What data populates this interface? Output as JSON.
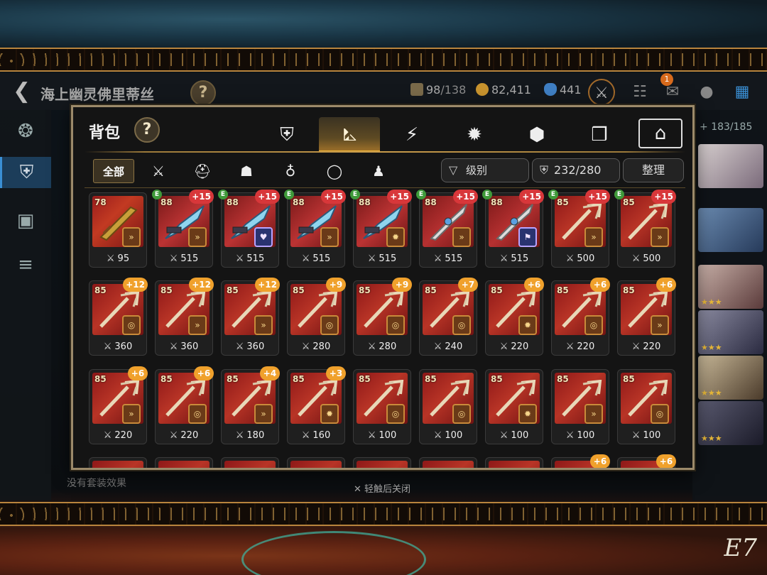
{
  "header": {
    "hero_name": "海上幽灵佛里蒂丝",
    "help": "?",
    "stamina": "98",
    "stamina_max": "/138",
    "gold": "82,411",
    "gems": "441",
    "mail_badge": "1"
  },
  "roster": {
    "count": "183/185"
  },
  "behind": {
    "no_set": "没有套装效果",
    "close_hint": "✕ 轻触后关闭"
  },
  "modal": {
    "title": "背包",
    "help": "?",
    "sub_all": "全部",
    "sort_label": "级别",
    "capacity": "232/280",
    "arrange": "整理"
  },
  "items": [
    {
      "lvl": "78",
      "enh": "",
      "enh_color": "",
      "e": false,
      "stat": "95",
      "art": "gold",
      "set": "»"
    },
    {
      "lvl": "88",
      "enh": "+15",
      "enh_color": "red",
      "e": true,
      "stat": "515",
      "art": "blue",
      "set": "»"
    },
    {
      "lvl": "88",
      "enh": "+15",
      "enh_color": "red",
      "e": true,
      "stat": "515",
      "art": "blue",
      "set": "♥"
    },
    {
      "lvl": "88",
      "enh": "+15",
      "enh_color": "red",
      "e": true,
      "stat": "515",
      "art": "blue",
      "set": "»"
    },
    {
      "lvl": "88",
      "enh": "+15",
      "enh_color": "red",
      "e": true,
      "stat": "515",
      "art": "blue",
      "set": "✹"
    },
    {
      "lvl": "88",
      "enh": "+15",
      "enh_color": "red",
      "e": true,
      "stat": "515",
      "art": "purple",
      "set": "»"
    },
    {
      "lvl": "88",
      "enh": "+15",
      "enh_color": "red",
      "e": true,
      "stat": "515",
      "art": "purple",
      "set": "⚑"
    },
    {
      "lvl": "85",
      "enh": "+15",
      "enh_color": "red",
      "e": true,
      "stat": "500",
      "art": "red",
      "set": "»"
    },
    {
      "lvl": "85",
      "enh": "+15",
      "enh_color": "red",
      "e": true,
      "stat": "500",
      "art": "red",
      "set": "»"
    },
    {
      "lvl": "85",
      "enh": "+12",
      "enh_color": "orange",
      "e": false,
      "stat": "360",
      "art": "red",
      "set": "◎"
    },
    {
      "lvl": "85",
      "enh": "+12",
      "enh_color": "orange",
      "e": false,
      "stat": "360",
      "art": "red",
      "set": "»"
    },
    {
      "lvl": "85",
      "enh": "+12",
      "enh_color": "orange",
      "e": false,
      "stat": "360",
      "art": "red",
      "set": "»"
    },
    {
      "lvl": "85",
      "enh": "+9",
      "enh_color": "orange",
      "e": false,
      "stat": "280",
      "art": "red",
      "set": "◎"
    },
    {
      "lvl": "85",
      "enh": "+9",
      "enh_color": "orange",
      "e": false,
      "stat": "280",
      "art": "red",
      "set": "◎"
    },
    {
      "lvl": "85",
      "enh": "+7",
      "enh_color": "orange",
      "e": false,
      "stat": "240",
      "art": "red",
      "set": "◎"
    },
    {
      "lvl": "85",
      "enh": "+6",
      "enh_color": "orange",
      "e": false,
      "stat": "220",
      "art": "red",
      "set": "✹"
    },
    {
      "lvl": "85",
      "enh": "+6",
      "enh_color": "orange",
      "e": false,
      "stat": "220",
      "art": "red",
      "set": "◎"
    },
    {
      "lvl": "85",
      "enh": "+6",
      "enh_color": "orange",
      "e": false,
      "stat": "220",
      "art": "red",
      "set": "»"
    },
    {
      "lvl": "85",
      "enh": "+6",
      "enh_color": "orange",
      "e": false,
      "stat": "220",
      "art": "red",
      "set": "»"
    },
    {
      "lvl": "85",
      "enh": "+6",
      "enh_color": "orange",
      "e": false,
      "stat": "220",
      "art": "red",
      "set": "◎"
    },
    {
      "lvl": "85",
      "enh": "+4",
      "enh_color": "orange",
      "e": false,
      "stat": "180",
      "art": "red",
      "set": "»"
    },
    {
      "lvl": "85",
      "enh": "+3",
      "enh_color": "orange",
      "e": false,
      "stat": "160",
      "art": "red",
      "set": "✹"
    },
    {
      "lvl": "85",
      "enh": "",
      "enh_color": "",
      "e": false,
      "stat": "100",
      "art": "red",
      "set": "◎"
    },
    {
      "lvl": "85",
      "enh": "",
      "enh_color": "",
      "e": false,
      "stat": "100",
      "art": "red",
      "set": "◎"
    },
    {
      "lvl": "85",
      "enh": "",
      "enh_color": "",
      "e": false,
      "stat": "100",
      "art": "red",
      "set": "✹"
    },
    {
      "lvl": "85",
      "enh": "",
      "enh_color": "",
      "e": false,
      "stat": "100",
      "art": "red",
      "set": "»"
    },
    {
      "lvl": "85",
      "enh": "",
      "enh_color": "",
      "e": false,
      "stat": "100",
      "art": "red",
      "set": "◎"
    },
    {
      "lvl": "",
      "enh": "",
      "enh_color": "",
      "e": false,
      "stat": "",
      "art": "red",
      "set": ""
    },
    {
      "lvl": "",
      "enh": "",
      "enh_color": "",
      "e": false,
      "stat": "",
      "art": "red",
      "set": ""
    },
    {
      "lvl": "",
      "enh": "",
      "enh_color": "",
      "e": false,
      "stat": "",
      "art": "red",
      "set": ""
    },
    {
      "lvl": "",
      "enh": "",
      "enh_color": "",
      "e": false,
      "stat": "",
      "art": "red",
      "set": ""
    },
    {
      "lvl": "",
      "enh": "",
      "enh_color": "",
      "e": false,
      "stat": "",
      "art": "red",
      "set": ""
    },
    {
      "lvl": "",
      "enh": "",
      "enh_color": "",
      "e": false,
      "stat": "",
      "art": "red",
      "set": ""
    },
    {
      "lvl": "",
      "enh": "",
      "enh_color": "",
      "e": false,
      "stat": "",
      "art": "red",
      "set": ""
    },
    {
      "lvl": "",
      "enh": "+6",
      "enh_color": "orange",
      "e": false,
      "stat": "",
      "art": "red",
      "set": ""
    },
    {
      "lvl": "",
      "enh": "+6",
      "enh_color": "orange",
      "e": false,
      "stat": "",
      "art": "red",
      "set": ""
    }
  ]
}
